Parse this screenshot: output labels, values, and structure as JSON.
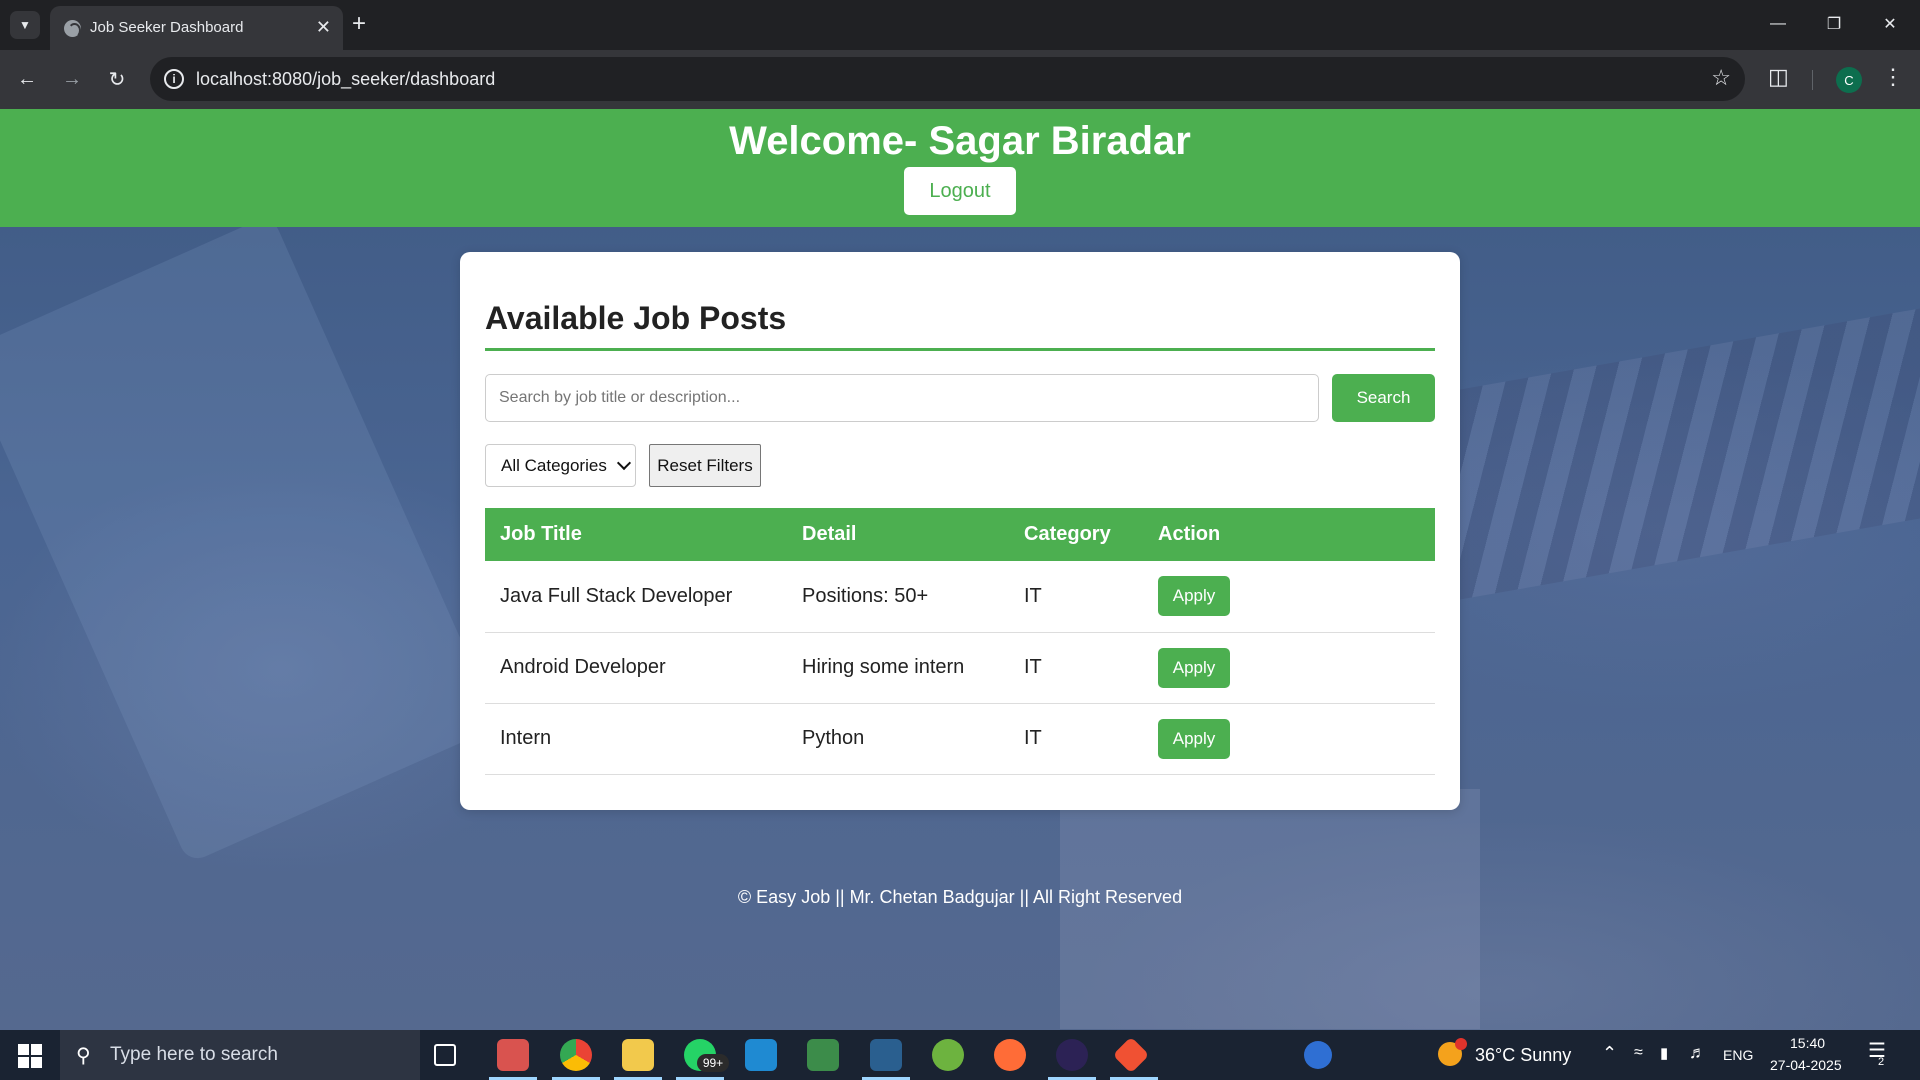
{
  "browser": {
    "tab_title": "Job Seeker Dashboard",
    "url": "localhost:8080/job_seeker/dashboard",
    "profile_initial": "C"
  },
  "header": {
    "welcome": "Welcome- Sagar Biradar",
    "logout_label": "Logout"
  },
  "jobs": {
    "title": "Available Job Posts",
    "search_placeholder": "Search by job title or description...",
    "search_label": "Search",
    "category_selected": "All Categories",
    "reset_label": "Reset Filters",
    "columns": [
      "Job Title",
      "Detail",
      "Category",
      "Action"
    ],
    "rows": [
      {
        "title": "Java Full Stack Developer",
        "detail": "Positions: 50+",
        "category": "IT",
        "action": "Apply"
      },
      {
        "title": "Android Developer",
        "detail": "Hiring some intern",
        "category": "IT",
        "action": "Apply"
      },
      {
        "title": "Intern",
        "detail": "Python",
        "category": "IT",
        "action": "Apply"
      }
    ]
  },
  "footer": {
    "text": "© Easy Job || Mr. Chetan Badgujar || All Right Reserved"
  },
  "taskbar": {
    "search_placeholder": "Type here to search",
    "whatsapp_badge": "99+",
    "weather": "36°C  Sunny",
    "language": "ENG",
    "time": "15:40",
    "date": "27-04-2025",
    "notification_count": "2"
  },
  "colors": {
    "accent": "#4caf50",
    "chrome_dark": "#202124",
    "chrome_toolbar": "#35363a",
    "taskbar": "#1a2332"
  }
}
